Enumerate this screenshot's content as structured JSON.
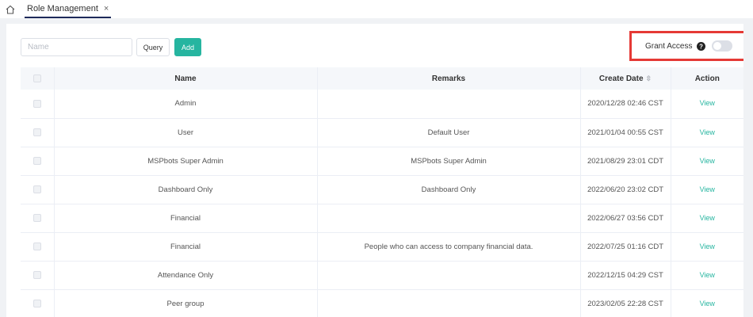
{
  "tab": {
    "title": "Role Management",
    "close": "×"
  },
  "toolbar": {
    "name_placeholder": "Name",
    "name_value": "",
    "query_label": "Query",
    "add_label": "Add",
    "grant_label": "Grant Access",
    "grant_enabled": false
  },
  "table": {
    "headers": {
      "name": "Name",
      "remarks": "Remarks",
      "create_date": "Create Date",
      "action": "Action"
    },
    "rows": [
      {
        "name": "Admin",
        "remarks": "",
        "date": "2020/12/28 02:46 CST",
        "action": "View"
      },
      {
        "name": "User",
        "remarks": "Default User",
        "date": "2021/01/04 00:55 CST",
        "action": "View"
      },
      {
        "name": "MSPbots Super Admin",
        "remarks": "MSPbots Super Admin",
        "date": "2021/08/29 23:01 CDT",
        "action": "View"
      },
      {
        "name": "Dashboard Only",
        "remarks": "Dashboard Only",
        "date": "2022/06/20 23:02 CDT",
        "action": "View"
      },
      {
        "name": "Financial",
        "remarks": "",
        "date": "2022/06/27 03:56 CDT",
        "action": "View"
      },
      {
        "name": "Financial",
        "remarks": "People who can access to company financial data.",
        "date": "2022/07/25 01:16 CDT",
        "action": "View"
      },
      {
        "name": "Attendance Only",
        "remarks": "",
        "date": "2022/12/15 04:29 CST",
        "action": "View"
      },
      {
        "name": "Peer group",
        "remarks": "",
        "date": "2023/02/05 22:28 CST",
        "action": "View"
      }
    ]
  },
  "colors": {
    "accent": "#26b5a0",
    "highlight": "#e53935",
    "tab_underline": "#1e2a5a"
  }
}
